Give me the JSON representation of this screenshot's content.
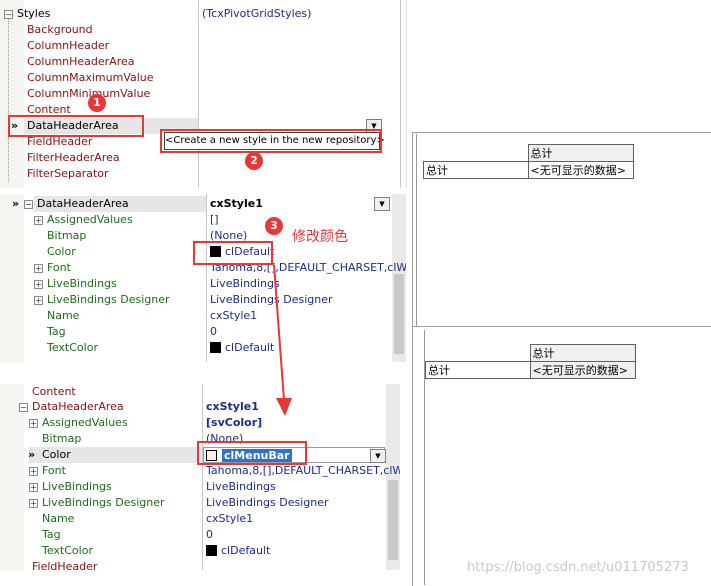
{
  "panel1": {
    "root_label": "Styles",
    "root_value": "(TcxPivotGridStyles)",
    "items": [
      "Background",
      "ColumnHeader",
      "ColumnHeaderArea",
      "ColumnMaximumValue",
      "ColumnMinimumValue",
      "Content",
      "DataHeaderArea",
      "FieldHeader",
      "FilterHeaderArea",
      "FilterSeparator"
    ],
    "dropdown_text": "<Create a new style in the new repository>"
  },
  "panel2": {
    "header_label": "DataHeaderArea",
    "header_value": "cxStyle1",
    "rows": [
      {
        "label": "AssignedValues",
        "value": "[]"
      },
      {
        "label": "Bitmap",
        "value": "(None)"
      },
      {
        "label": "Color",
        "value": "clDefault"
      },
      {
        "label": "Font",
        "value": "Tahoma,8,[],DEFAULT_CHARSET,clW"
      },
      {
        "label": "LiveBindings",
        "value": "LiveBindings"
      },
      {
        "label": "LiveBindings Designer",
        "value": "LiveBindings Designer"
      },
      {
        "label": "Name",
        "value": "cxStyle1"
      },
      {
        "label": "Tag",
        "value": "0"
      },
      {
        "label": "TextColor",
        "value": "clDefault"
      }
    ]
  },
  "panel3": {
    "top_label": "Content",
    "header_label": "DataHeaderArea",
    "header_value": "cxStyle1",
    "rows": [
      {
        "label": "AssignedValues",
        "value": "[svColor]"
      },
      {
        "label": "Bitmap",
        "value": "(None)"
      },
      {
        "label": "Color",
        "value": "clMenuBar"
      },
      {
        "label": "Font",
        "value": "Tahoma,8,[],DEFAULT_CHARSET,clW"
      },
      {
        "label": "LiveBindings",
        "value": "LiveBindings"
      },
      {
        "label": "LiveBindings Designer",
        "value": "LiveBindings Designer"
      },
      {
        "label": "Name",
        "value": "cxStyle1"
      },
      {
        "label": "Tag",
        "value": "0"
      },
      {
        "label": "TextColor",
        "value": "clDefault"
      }
    ],
    "bottom_label": "FieldHeader"
  },
  "grid1": {
    "header": "总计",
    "row_label": "总计",
    "cell": "<无可显示的数据>"
  },
  "grid2": {
    "header": "总计",
    "row_label": "总计",
    "cell": "<无可显示的数据>"
  },
  "annotations": {
    "b1": "1",
    "b2": "2",
    "b3": "3",
    "note": "修改颜色"
  },
  "watermark": "https://blog.csdn.net/u011705273",
  "colors": {
    "annotation_red": "#e53935",
    "black_swatch": "#000000",
    "menubar_swatch": "#f0f0f0"
  }
}
